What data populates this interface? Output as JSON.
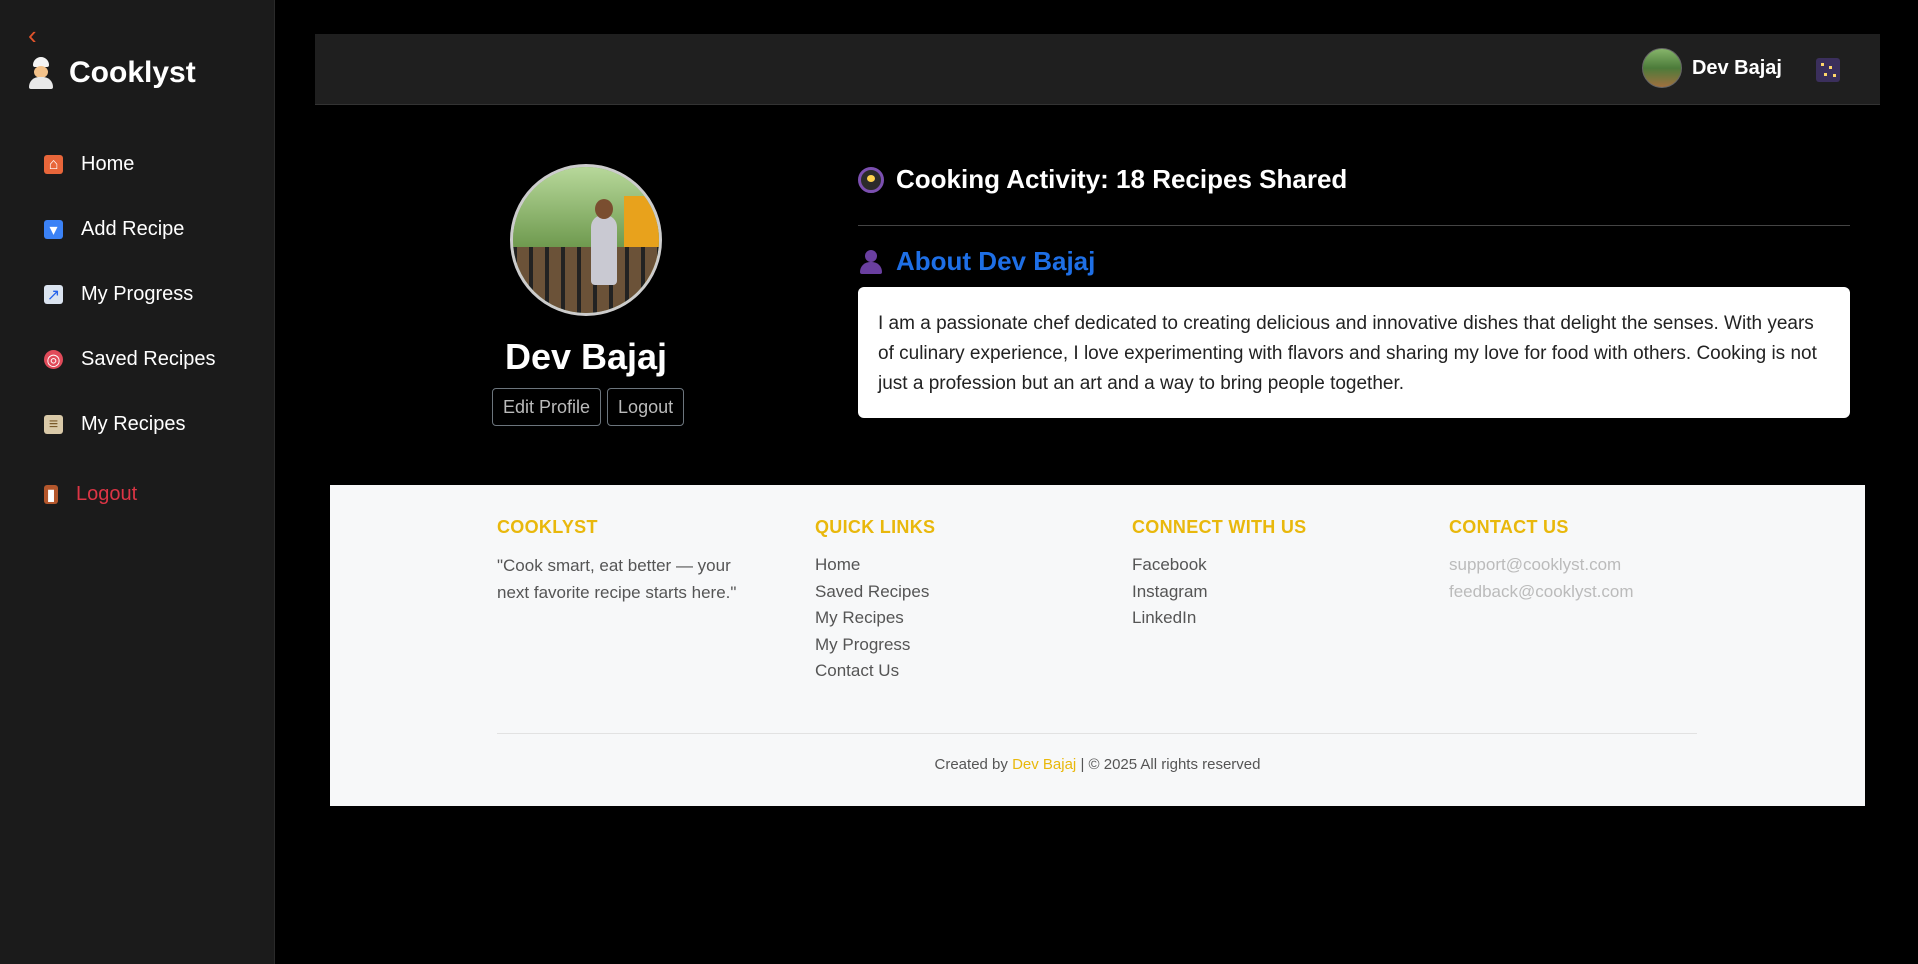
{
  "app": {
    "name": "Cooklyst"
  },
  "sidebar": {
    "items": [
      {
        "label": "Home",
        "icon": "house-icon",
        "color": "#e8663a"
      },
      {
        "label": "Add Recipe",
        "icon": "inbox-icon",
        "color": "#3b82f6"
      },
      {
        "label": "My Progress",
        "icon": "chart-up-icon",
        "color": "#dbe4f0"
      },
      {
        "label": "Saved Recipes",
        "icon": "target-icon",
        "color": "#e14b5a"
      },
      {
        "label": "My Recipes",
        "icon": "clipboard-icon",
        "color": "#d9c9a8"
      }
    ],
    "logout": {
      "label": "Logout",
      "icon": "door-icon",
      "color": "#dc3545"
    }
  },
  "topbar": {
    "user_name": "Dev Bajaj"
  },
  "profile": {
    "name": "Dev Bajaj",
    "edit_label": "Edit Profile",
    "logout_label": "Logout",
    "activity": "Cooking Activity: 18 Recipes Shared",
    "about_title": "About Dev Bajaj",
    "about_text": "I am a passionate chef dedicated to creating delicious and innovative dishes that delight the senses. With years of culinary experience, I love experimenting with flavors and sharing my love for food with others. Cooking is not just a profession but an art and a way to bring people together."
  },
  "footer": {
    "brand_title": "COOKLYST",
    "tagline": "\"Cook smart, eat better — your next favorite recipe starts here.\"",
    "quick_links_title": "QUICK LINKS",
    "quick_links": [
      "Home",
      "Saved Recipes",
      "My Recipes",
      "My Progress",
      "Contact Us"
    ],
    "connect_title": "CONNECT WITH US",
    "social": [
      "Facebook",
      "Instagram",
      "LinkedIn"
    ],
    "contact_title": "CONTACT US",
    "emails": [
      "support@cooklyst.com",
      "feedback@cooklyst.com"
    ],
    "credit_prefix": "Created by",
    "credit_name": "Dev Bajaj",
    "credit_suffix": "| © 2025 All rights reserved"
  },
  "colors": {
    "accent": "#e9b80c",
    "link_blue": "#1e6fe6",
    "danger": "#dc3545",
    "sidebar_bg": "#1b1b1b"
  }
}
